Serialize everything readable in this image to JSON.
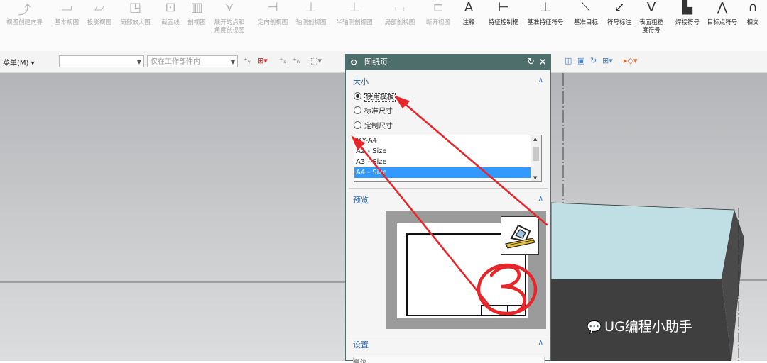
{
  "ribbon": {
    "buttons": [
      {
        "label": "视图创建向导",
        "icon": "view-wizard-icon"
      },
      {
        "label": "基本视图",
        "icon": "base-view-icon"
      },
      {
        "label": "投影视图",
        "icon": "projected-view-icon"
      },
      {
        "label": "局部放大图",
        "icon": "detail-view-icon"
      },
      {
        "label": "截面线",
        "icon": "section-line-icon"
      },
      {
        "label": "剖视图",
        "icon": "section-view-icon"
      },
      {
        "label": "展开的点和",
        "label2": "角度剖视图",
        "icon": "unfolded-section-icon"
      },
      {
        "label": "定向剖视图",
        "icon": "oriented-section-icon"
      },
      {
        "label": "轴测剖视图",
        "icon": "axonometric-section-icon"
      },
      {
        "label": "半轴测剖视图",
        "icon": "half-axonometric-icon"
      },
      {
        "label": "局部剖视图",
        "icon": "break-out-section-icon"
      },
      {
        "label": "断开视图",
        "icon": "broken-view-icon"
      },
      {
        "label": "注释",
        "icon": "note-icon"
      },
      {
        "label": "特征控制框",
        "icon": "feature-control-frame-icon"
      },
      {
        "label": "基准特征符号",
        "icon": "datum-feature-icon"
      },
      {
        "label": "基准目标",
        "icon": "datum-target-icon"
      },
      {
        "label": "符号标注",
        "icon": "symbol-note-icon"
      },
      {
        "label": "表面粗糙",
        "label2": "度符号",
        "icon": "surface-finish-icon"
      },
      {
        "label": "焊接符号",
        "icon": "weld-symbol-icon"
      },
      {
        "label": "目标点符号",
        "icon": "target-point-icon"
      },
      {
        "label": "相交",
        "icon": "intersection-icon"
      }
    ]
  },
  "toolbar": {
    "menu_label": "菜单(M) ▾",
    "combo1_value": "",
    "combo2_value": "仅在工作部件内"
  },
  "dialog": {
    "title": "图纸页",
    "size_section": "大小",
    "options": [
      "使用模板",
      "标准尺寸",
      "定制尺寸"
    ],
    "selected_option": "使用模板",
    "templates": [
      "MY-A4",
      "A2 - Size",
      "A3 - Size",
      "A4 - Size"
    ],
    "selected_template": "A4 - Size",
    "preview_section": "预览",
    "settings_section": "设置",
    "settings_field": "单位"
  },
  "annotations": {
    "marker": "3",
    "color": "#e8262a"
  },
  "watermark": {
    "text": "UG编程小助手"
  },
  "colors": {
    "dialog_title_bg": "#4d6e6b",
    "section_header": "#2a66b8",
    "list_selection": "#3399ff",
    "solid_top": "#bfdfe4",
    "solid_side": "#4a4a4a"
  }
}
